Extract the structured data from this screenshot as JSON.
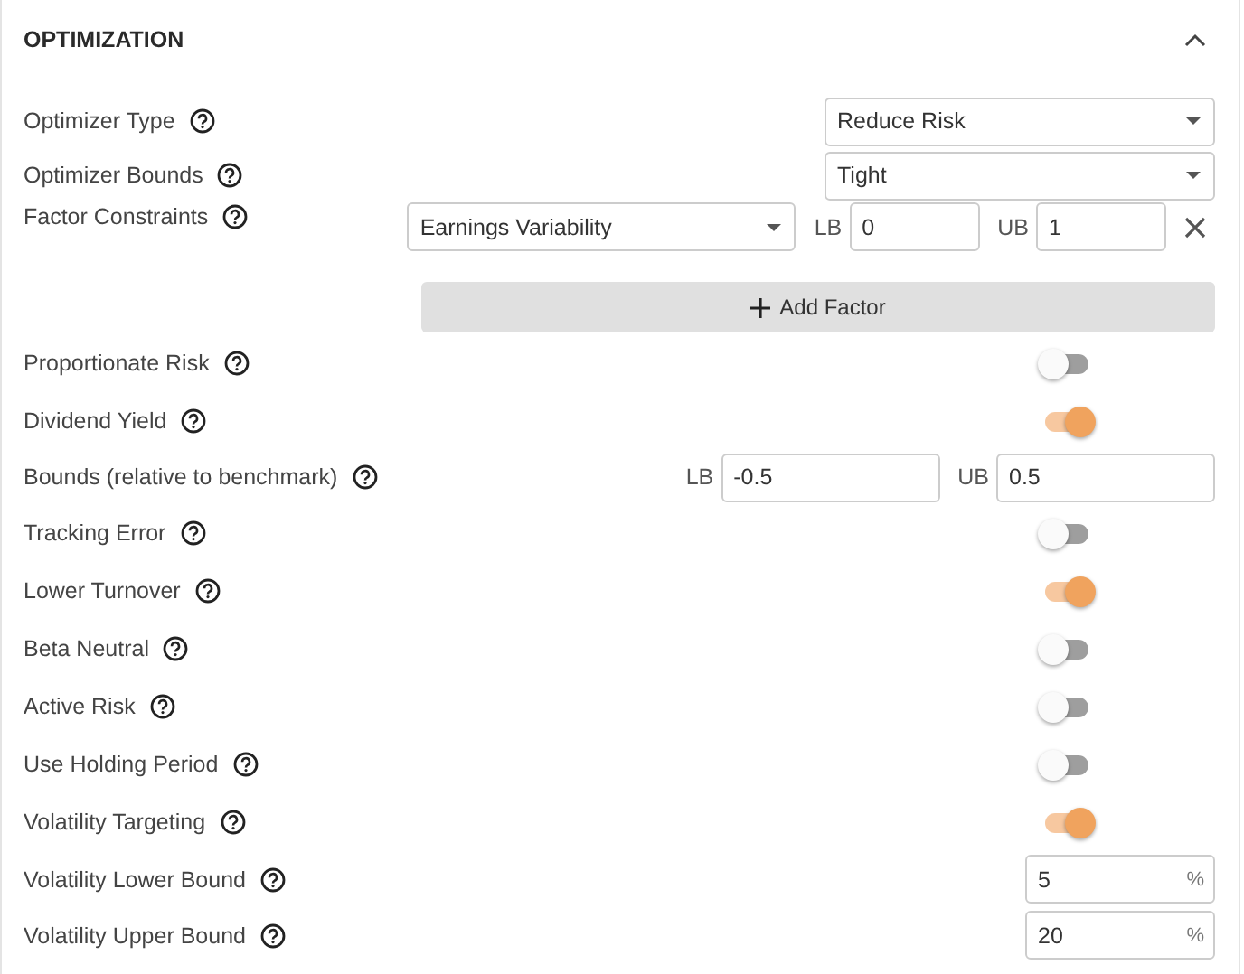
{
  "section": {
    "title": "OPTIMIZATION",
    "expanded": true
  },
  "rows": [
    {
      "kind": "select",
      "label": "Optimizer Type",
      "value": "Reduce Risk"
    },
    {
      "kind": "select",
      "label": "Optimizer Bounds",
      "value": "Tight"
    },
    {
      "kind": "factor",
      "label": "Factor Constraints",
      "factor": "Earnings Variability",
      "lb_label": "LB",
      "lb": "0",
      "ub_label": "UB",
      "ub": "1"
    },
    {
      "kind": "add",
      "button": "Add Factor"
    },
    {
      "kind": "toggle",
      "label": "Proportionate Risk",
      "on": false
    },
    {
      "kind": "toggle",
      "label": "Dividend Yield",
      "on": true
    },
    {
      "kind": "bounds",
      "label": "Bounds (relative to benchmark)",
      "lb_label": "LB",
      "lb": "-0.5",
      "ub_label": "UB",
      "ub": "0.5"
    },
    {
      "kind": "toggle",
      "label": "Tracking Error",
      "on": false
    },
    {
      "kind": "toggle",
      "label": "Lower Turnover",
      "on": true
    },
    {
      "kind": "toggle",
      "label": "Beta Neutral",
      "on": false
    },
    {
      "kind": "toggle",
      "label": "Active Risk",
      "on": false
    },
    {
      "kind": "toggle",
      "label": "Use Holding Period",
      "on": false
    },
    {
      "kind": "toggle",
      "label": "Volatility Targeting",
      "on": true
    },
    {
      "kind": "percent",
      "label": "Volatility Lower Bound",
      "value": "5",
      "unit": "%"
    },
    {
      "kind": "percent",
      "label": "Volatility Upper Bound",
      "value": "20",
      "unit": "%"
    }
  ]
}
